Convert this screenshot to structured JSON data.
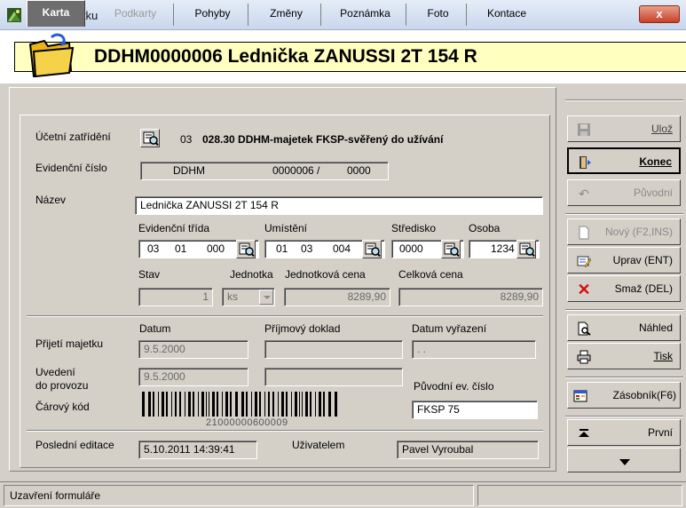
{
  "window": {
    "title": "Karta majetku",
    "close_label": "x"
  },
  "header": {
    "title": "DDHM0000006 Lednička ZANUSSI 2T 154 R"
  },
  "tabs": [
    {
      "label": "Karta"
    },
    {
      "label": "Podkarty"
    },
    {
      "label": "Pohyby"
    },
    {
      "label": "Změny"
    },
    {
      "label": "Poznámka"
    },
    {
      "label": "Foto"
    },
    {
      "label": "Kontace"
    }
  ],
  "form": {
    "ucetni_zatrideni": {
      "label": "Účetní zatřídění",
      "code": "03",
      "value": "028.30 DDHM-majetek FKSP-svěřený do užívání"
    },
    "evidencni_cislo": {
      "label": "Evidenční číslo",
      "prefix": "DDHM",
      "number": "0000006 /",
      "suffix": "0000"
    },
    "nazev": {
      "label": "Název",
      "value": "Lednička ZANUSSI 2T 154 R"
    },
    "evidencni_trida": {
      "label": "Evidenční třída",
      "a": "03",
      "b": "01",
      "c": "000"
    },
    "umisteni": {
      "label": "Umístění",
      "a": "01",
      "b": "03",
      "c": "004"
    },
    "stredisko": {
      "label": "Středisko",
      "value": "0000"
    },
    "osoba": {
      "label": "Osoba",
      "value": "1234"
    },
    "stav": {
      "label": "Stav",
      "value": "1"
    },
    "jednotka": {
      "label": "Jednotka",
      "value": "ks"
    },
    "jednotkova_cena": {
      "label": "Jednotková cena",
      "value": "8289,90"
    },
    "celkova_cena": {
      "label": "Celková cena",
      "value": "8289,90"
    },
    "col_datum": "Datum",
    "col_prijmovy_doklad": "Příjmový doklad",
    "col_datum_vyrazeni": "Datum vyřazení",
    "prijeti_majetku": {
      "label": "Přijetí majetku",
      "datum": "9.5.2000",
      "doklad": "",
      "vyrazeni": ". ."
    },
    "uvedeni": {
      "label_line1": "Uvedení",
      "label_line2": "do provozu",
      "datum": "9.5.2000",
      "doklad": ""
    },
    "puvodni_ev_cislo": {
      "label": "Původní ev. číslo",
      "value": "FKSP 75"
    },
    "carovy_kod": {
      "label": "Čárový kód",
      "number": "21000000600009"
    },
    "posledni_editace": {
      "label": "Poslední editace",
      "value": "5.10.2011 14:39:41"
    },
    "uzivatelem": {
      "label": "Uživatelem",
      "value": "Pavel Vyroubal"
    }
  },
  "buttons": {
    "uloz": "Ulož",
    "konec": "Konec",
    "puvodni": "Původní",
    "novy": "Nový (F2,INS)",
    "uprav": "Uprav (ENT)",
    "smaz": "Smaž (DEL)",
    "nahled": "Náhled",
    "tisk": "Tisk",
    "zasobnik": "Zásobník(F6)",
    "prvni": "První"
  },
  "status": {
    "text": "Uzavření formuláře",
    "right": ""
  }
}
